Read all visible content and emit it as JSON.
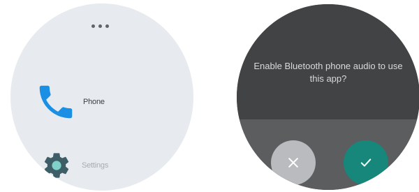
{
  "launcher": {
    "overflow_icon": "more-horizontal-icon",
    "apps": [
      {
        "label": "Phone",
        "icon": "phone-icon",
        "icon_color": "#1a8fe3"
      },
      {
        "label": "Settings",
        "icon": "gear-icon",
        "icon_color": "#3d5e66"
      }
    ]
  },
  "dialog": {
    "message": "Enable Bluetooth phone audio to use this app?",
    "cancel_icon": "close-icon",
    "confirm_icon": "check-icon",
    "cancel_color": "#b9bbbe",
    "confirm_color": "#16877a"
  }
}
